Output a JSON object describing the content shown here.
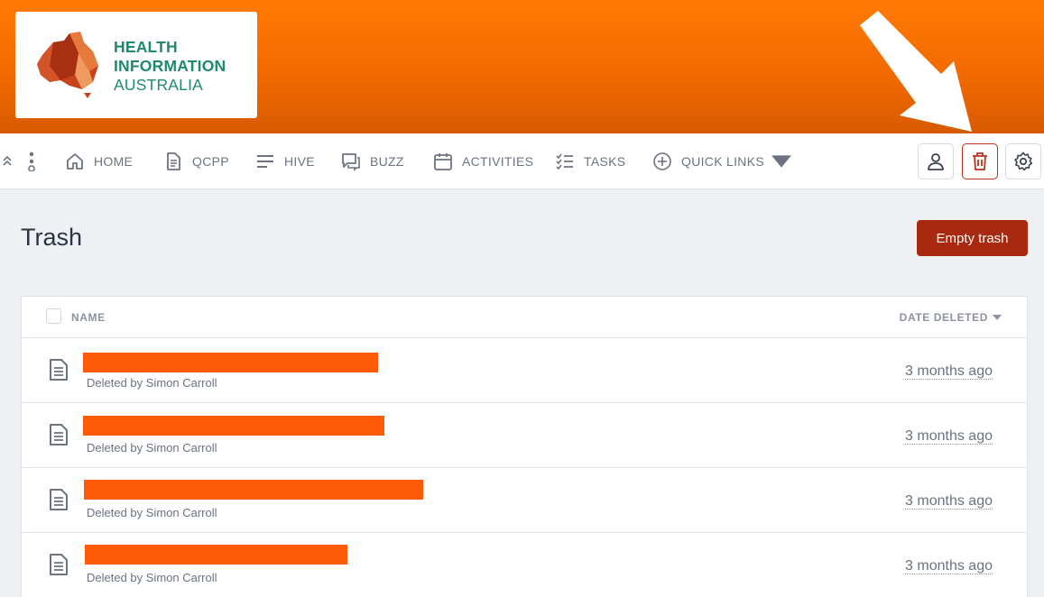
{
  "brand": {
    "line1": "HEALTH",
    "line2": "INFORMATION",
    "line3": "AUSTRALIA",
    "color": "#1f8a6d"
  },
  "header": {
    "color": "#f26a00"
  },
  "nav": {
    "items": [
      {
        "label": "HOME",
        "icon": "home-icon"
      },
      {
        "label": "QCPP",
        "icon": "document-icon"
      },
      {
        "label": "HIVE",
        "icon": "lines-icon"
      },
      {
        "label": "BUZZ",
        "icon": "chat-icon"
      },
      {
        "label": "ACTIVITIES",
        "icon": "calendar-icon"
      },
      {
        "label": "TASKS",
        "icon": "checklist-icon"
      },
      {
        "label": "QUICK LINKS",
        "icon": "plus-circle-icon"
      }
    ],
    "actions": [
      "user-icon",
      "trash-icon",
      "gear-icon"
    ]
  },
  "page": {
    "title": "Trash",
    "empty_button": "Empty trash",
    "button_color": "#a8290f"
  },
  "table": {
    "columns": {
      "name": "NAME",
      "date": "DATE DELETED"
    },
    "rows": [
      {
        "deleted_by": "Deleted by Simon Carroll",
        "when": "3 months ago"
      },
      {
        "deleted_by": "Deleted by Simon Carroll",
        "when": "3 months ago"
      },
      {
        "deleted_by": "Deleted by Simon Carroll",
        "when": "3 months ago"
      },
      {
        "deleted_by": "Deleted by Simon Carroll",
        "when": "3 months ago"
      }
    ],
    "redaction_color": "#ff5a05"
  }
}
